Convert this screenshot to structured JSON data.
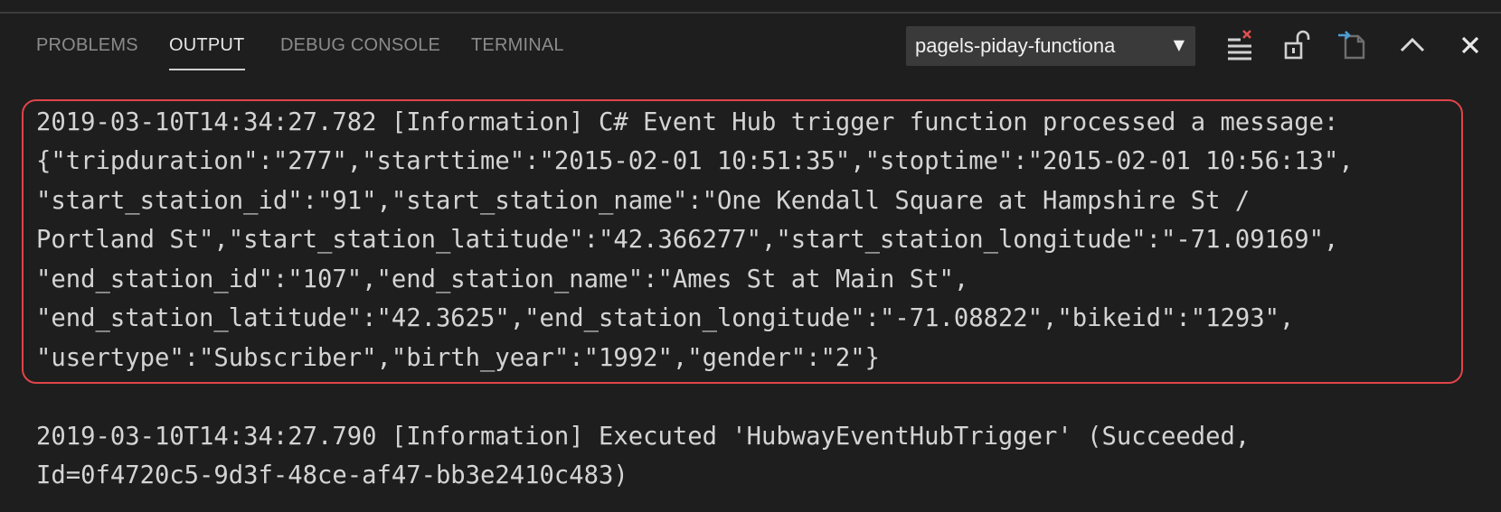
{
  "tabs": [
    {
      "label": "PROBLEMS",
      "active": false
    },
    {
      "label": "OUTPUT",
      "active": true
    },
    {
      "label": "DEBUG CONSOLE",
      "active": false
    },
    {
      "label": "TERMINAL",
      "active": false
    }
  ],
  "output_channel": {
    "selected": "pagels-piday-functiona",
    "arrow": "▼"
  },
  "toolbar_icons": [
    "clear-output-icon",
    "lock-scroll-icon",
    "open-log-file-icon",
    "maximize-panel-icon",
    "close-panel-icon"
  ],
  "log": {
    "highlighted_lines": [
      "2019-03-10T14:34:27.782 [Information] C# Event Hub trigger function processed a message:",
      "{\"tripduration\":\"277\",\"starttime\":\"2015-02-01 10:51:35\",\"stoptime\":\"2015-02-01 10:56:13\",",
      "\"start_station_id\":\"91\",\"start_station_name\":\"One Kendall Square at Hampshire St /",
      "Portland St\",\"start_station_latitude\":\"42.366277\",\"start_station_longitude\":\"-71.09169\",",
      "\"end_station_id\":\"107\",\"end_station_name\":\"Ames St at Main St\",",
      "\"end_station_latitude\":\"42.3625\",\"end_station_longitude\":\"-71.08822\",\"bikeid\":\"1293\",",
      "\"usertype\":\"Subscriber\",\"birth_year\":\"1992\",\"gender\":\"2\"}"
    ],
    "next_lines": [
      "2019-03-10T14:34:27.790 [Information] Executed 'HubwayEventHubTrigger' (Succeeded,",
      "Id=0f4720c5-9d3f-48ce-af47-bb3e2410c483)"
    ]
  },
  "colors": {
    "background": "#1e1e1e",
    "highlight_border": "#e0444a",
    "text": "#d4d4d4",
    "clear_icon_accent": "#e05050",
    "file_icon_accent": "#4b9fd6"
  }
}
